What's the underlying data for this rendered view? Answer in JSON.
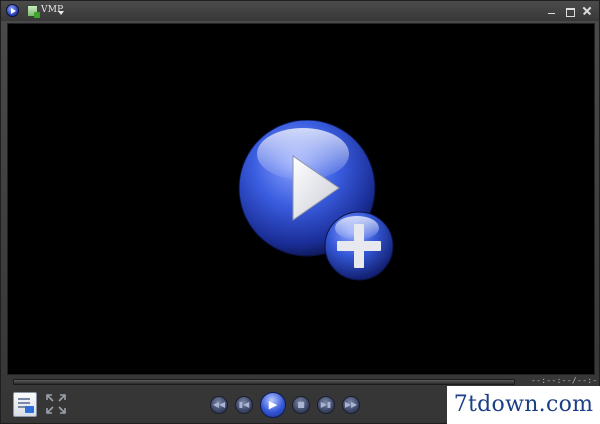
{
  "titlebar": {
    "menu_label": "VMP"
  },
  "player": {
    "time_readout": "--:--:--/--:--:--"
  },
  "icons": {
    "app": "media-player-icon",
    "menu": "file-menu-icon",
    "open": "open-file-plus-icon",
    "playlist": "playlist-icon",
    "fullscreen": "fullscreen-icon",
    "prev": "previous-icon",
    "rew": "rewind-icon",
    "play": "play-icon",
    "stop": "stop-icon",
    "fwd": "fast-forward-icon",
    "next": "next-icon"
  },
  "colors": {
    "accent": "#2f4fd0",
    "background": "#000000",
    "chrome": "#3d3d3d"
  },
  "watermark": {
    "text": "7tdown.com"
  }
}
